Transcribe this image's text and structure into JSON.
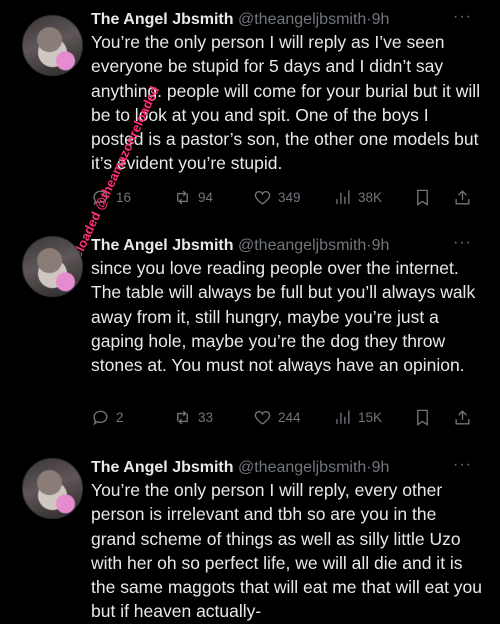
{
  "watermark_text": "reloaded @theamazonreloaded",
  "tweets": [
    {
      "name": "The Angel Jbsmith",
      "handle": "@theangeljbsmith",
      "separator": "·",
      "time": "9h",
      "more": "···",
      "text": "You’re the only person I will reply as I’ve seen everyone be stupid for 5 days and I didn’t say anything. people will come for your burial but it will be to look at you and spit. One of the boys I posted is a pastor’s son, the other one models but it’s evident you’re stupid.",
      "replies": "16",
      "retweets": "94",
      "likes": "349",
      "views": "38K"
    },
    {
      "name": "The Angel Jbsmith",
      "handle": "@theangeljbsmith",
      "separator": "·",
      "time": "9h",
      "more": "···",
      "text": "since you love reading people over the internet. The table will always be full but you’ll always walk away from it, still hungry, maybe you’re just a gaping hole, maybe you’re the dog they throw stones at. You must not always have an opinion.",
      "replies": "2",
      "retweets": "33",
      "likes": "244",
      "views": "15K"
    },
    {
      "name": "The Angel Jbsmith",
      "handle": "@theangeljbsmith",
      "separator": "·",
      "time": "9h",
      "more": "···",
      "text": "You’re the only person I will reply, every other person is irrelevant and tbh so are you in the grand scheme of things as well as silly little Uzo with her oh so perfect life, we will all die and it is the same maggots that will eat me that will eat you but if heaven actually-"
    }
  ]
}
